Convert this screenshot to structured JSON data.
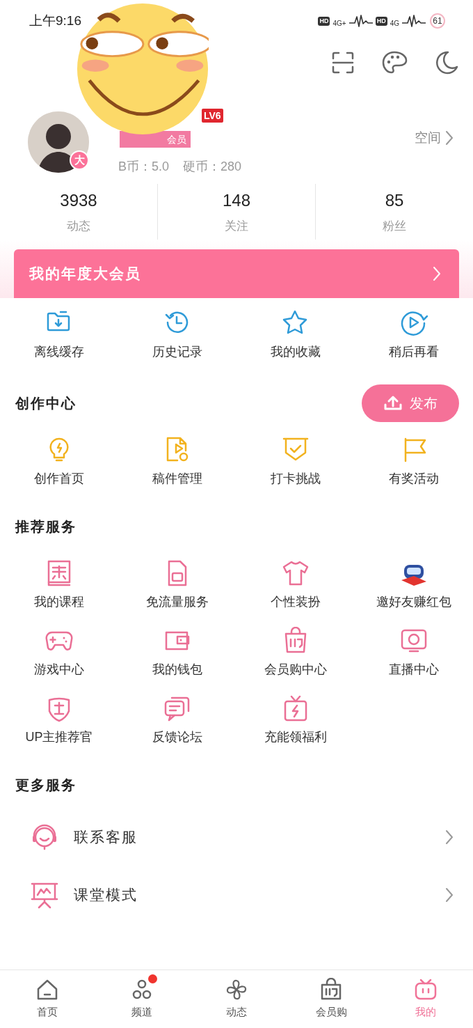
{
  "status_bar": {
    "time": "上午9:16",
    "indicators": [
      "HD",
      "4G+",
      "HD",
      "4G"
    ],
    "battery": "61"
  },
  "profile": {
    "avatar_badge": "大",
    "level": "LV6",
    "vip_tag": "会员",
    "coins": "B币：5.0",
    "hard_coins": "硬币：280",
    "space_link": "空间"
  },
  "stats": [
    {
      "value": "3938",
      "label": "动态"
    },
    {
      "value": "148",
      "label": "关注"
    },
    {
      "value": "85",
      "label": "粉丝"
    }
  ],
  "vip_banner": {
    "title": "我的年度大会员"
  },
  "quick_actions": [
    "离线缓存",
    "历史记录",
    "我的收藏",
    "稍后再看"
  ],
  "creation_center": {
    "title": "创作中心",
    "publish_button": "发布",
    "items": [
      "创作首页",
      "稿件管理",
      "打卡挑战",
      "有奖活动"
    ]
  },
  "recommended": {
    "title": "推荐服务",
    "items": [
      "我的课程",
      "免流量服务",
      "个性装扮",
      "邀好友赚红包",
      "游戏中心",
      "我的钱包",
      "会员购中心",
      "直播中心",
      "UP主推荐官",
      "反馈论坛",
      "充能领福利"
    ]
  },
  "more_services": {
    "title": "更多服务",
    "items": [
      "联系客服",
      "课堂模式"
    ]
  },
  "bottom_nav": [
    {
      "label": "首页",
      "selected": false,
      "dot": false
    },
    {
      "label": "频道",
      "selected": false,
      "dot": true
    },
    {
      "label": "动态",
      "selected": false,
      "dot": false
    },
    {
      "label": "会员购",
      "selected": false,
      "dot": false
    },
    {
      "label": "我的",
      "selected": true,
      "dot": false
    }
  ]
}
